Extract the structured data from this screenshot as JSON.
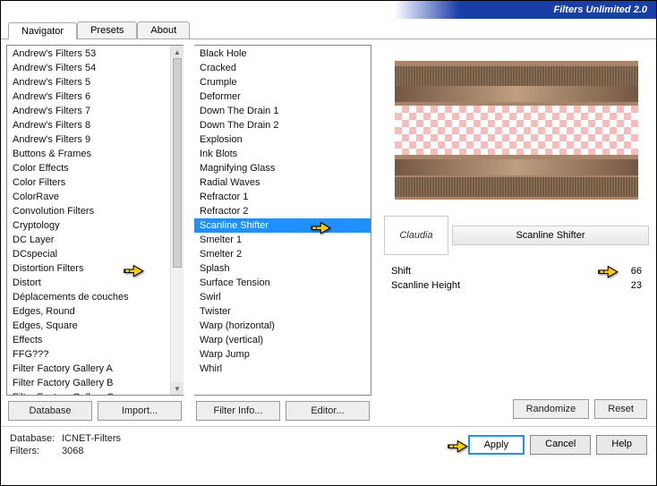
{
  "title": "Filters Unlimited 2.0",
  "tabs": [
    "Navigator",
    "Presets",
    "About"
  ],
  "active_tab": 0,
  "categories": [
    "Andrew's Filters 53",
    "Andrew's Filters 54",
    "Andrew's Filters 5",
    "Andrew's Filters 6",
    "Andrew's Filters 7",
    "Andrew's Filters 8",
    "Andrew's Filters 9",
    "Buttons & Frames",
    "Color Effects",
    "Color Filters",
    "ColorRave",
    "Convolution Filters",
    "Cryptology",
    "DC Layer",
    "DCspecial",
    "Distortion Filters",
    "Distort",
    "Déplacements de couches",
    "Edges, Round",
    "Edges, Square",
    "Effects",
    "FFG???",
    "Filter Factory Gallery A",
    "Filter Factory Gallery B",
    "Filter Factory Gallery C"
  ],
  "category_pointer_index": 15,
  "filters": [
    "Black Hole",
    "Cracked",
    "Crumple",
    "Deformer",
    "Down The Drain 1",
    "Down The Drain 2",
    "Explosion",
    "Ink Blots",
    "Magnifying Glass",
    "Radial Waves",
    "Refractor 1",
    "Refractor 2",
    "Scanline Shifter",
    "Smelter 1",
    "Smelter 2",
    "Splash",
    "Surface Tension",
    "Swirl",
    "Twister",
    "Warp (horizontal)",
    "Warp (vertical)",
    "Warp Jump",
    "Whirl"
  ],
  "selected_filter_index": 12,
  "selected_filter_name": "Scanline Shifter",
  "logo_text": "Claudia",
  "params": [
    {
      "label": "Shift",
      "value": 66
    },
    {
      "label": "Scanline Height",
      "value": 23
    }
  ],
  "param_pointer_index": 0,
  "left_buttons": [
    "Database",
    "Import...",
    "Filter Info...",
    "Editor..."
  ],
  "right_buttons": [
    "Randomize",
    "Reset"
  ],
  "status": {
    "database_label": "Database:",
    "database_value": "ICNET-Filters",
    "filters_label": "Filters:",
    "filters_value": "3068"
  },
  "action_buttons": {
    "apply": "Apply",
    "cancel": "Cancel",
    "help": "Help"
  }
}
